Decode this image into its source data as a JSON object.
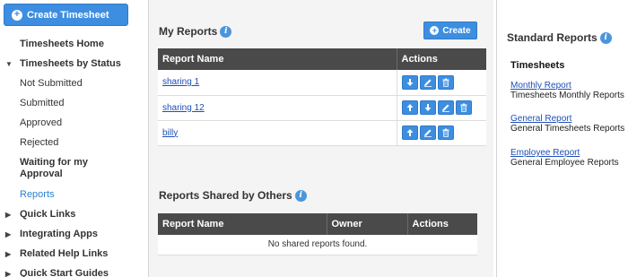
{
  "sidebar": {
    "create_label": "Create Timesheet",
    "items": [
      {
        "label": "Timesheets Home"
      },
      {
        "label": "Timesheets by Status"
      },
      {
        "label": "Not Submitted"
      },
      {
        "label": "Submitted"
      },
      {
        "label": "Approved"
      },
      {
        "label": "Rejected"
      },
      {
        "label": "Waiting for my Approval"
      },
      {
        "label": "Reports"
      },
      {
        "label": "Quick Links"
      },
      {
        "label": "Integrating Apps"
      },
      {
        "label": "Related Help Links"
      },
      {
        "label": "Quick Start Guides"
      }
    ]
  },
  "my_reports": {
    "title": "My Reports",
    "create_label": "Create",
    "columns": [
      "Report Name",
      "Actions"
    ],
    "rows": [
      {
        "name": "sharing 1",
        "actions": [
          "arrow-down-icon",
          "edit-icon",
          "trash-icon"
        ]
      },
      {
        "name": "sharing 12",
        "actions": [
          "arrow-up-icon",
          "arrow-down-icon",
          "edit-icon",
          "trash-icon"
        ]
      },
      {
        "name": "billy",
        "actions": [
          "arrow-up-icon",
          "edit-icon",
          "trash-icon"
        ]
      }
    ]
  },
  "shared_reports": {
    "title": "Reports Shared by Others",
    "columns": [
      "Report Name",
      "Owner",
      "Actions"
    ],
    "empty_text": "No shared reports found."
  },
  "standard_reports": {
    "title": "Standard Reports",
    "section": "Timesheets",
    "reports": [
      {
        "link": "Monthly Report",
        "desc": "Timesheets Monthly Reports"
      },
      {
        "link": "General Report",
        "desc": "General Timesheets Reports"
      },
      {
        "link": "Employee Report",
        "desc": "General Employee Reports"
      }
    ]
  },
  "colors": {
    "accent": "#3d8ee0",
    "header_dark": "#4a4a4a",
    "link": "#1f4fb8",
    "active_nav": "#2a7fd4"
  }
}
